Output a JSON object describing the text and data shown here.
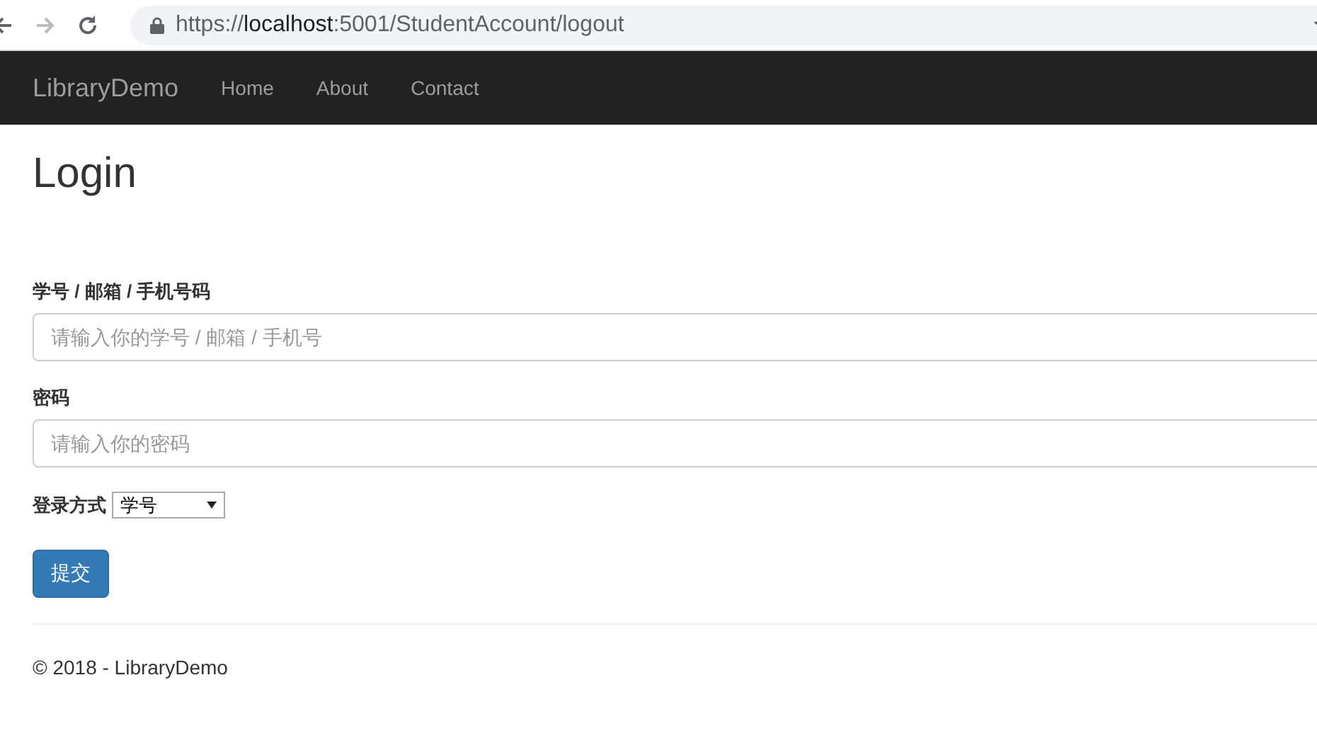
{
  "browser": {
    "url": {
      "scheme": "https://",
      "host": "localhost",
      "rest": ":5001/StudentAccount/logout"
    }
  },
  "navbar": {
    "brand": "LibraryDemo",
    "links": [
      {
        "label": "Home"
      },
      {
        "label": "About"
      },
      {
        "label": "Contact"
      }
    ]
  },
  "page": {
    "title": "Login",
    "fields": [
      {
        "label": "学号 / 邮箱 / 手机号码",
        "placeholder": "请输入你的学号 / 邮箱 / 手机号"
      },
      {
        "label": "密码",
        "placeholder": "请输入你的密码"
      }
    ],
    "login_method": {
      "label": "登录方式",
      "value": "学号"
    },
    "submit": "提交"
  },
  "footer": "© 2018 - LibraryDemo"
}
